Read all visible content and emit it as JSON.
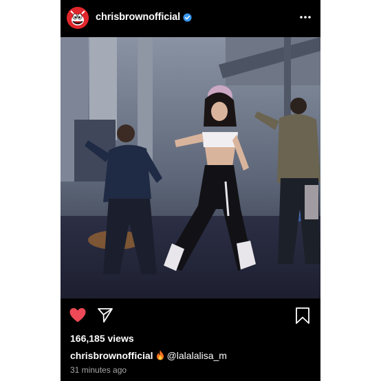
{
  "header": {
    "username": "chrisbrownofficial"
  },
  "post": {
    "views": "166,185 views",
    "caption_user": "chrisbrownofficial",
    "caption_mention": "@lalalalisa_m",
    "timestamp": "31 minutes ago"
  },
  "icons": {
    "avatar": "cartoon-mascot-avatar",
    "verified": "verified-badge-icon",
    "more": "more-options-icon",
    "like": "heart-icon",
    "share": "send-icon",
    "save": "bookmark-icon",
    "emoji": "fire-emoji"
  },
  "colors": {
    "background": "#000000",
    "like_active": "#ed4956",
    "verified": "#3897f0",
    "timestamp": "#a8a8a8"
  }
}
